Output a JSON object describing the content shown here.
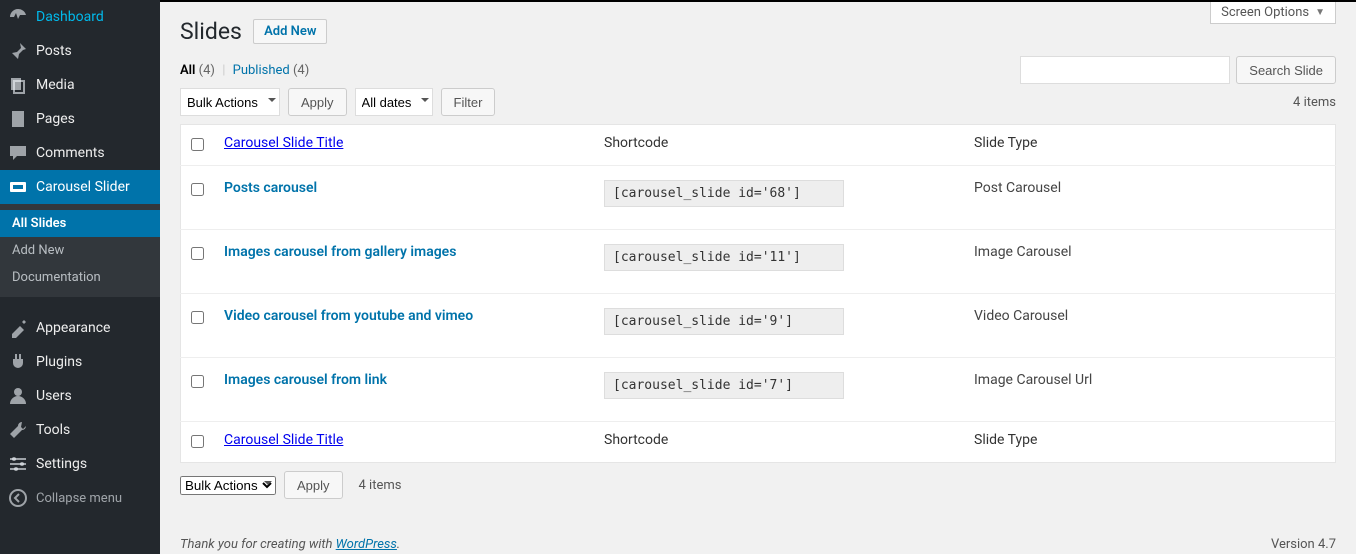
{
  "screen_options_label": "Screen Options",
  "page_title": "Slides",
  "add_new_label": "Add New",
  "subsubsub": {
    "all_label": "All",
    "all_count": "(4)",
    "published_label": "Published",
    "published_count": "(4)"
  },
  "search_button": "Search Slide",
  "bulk_actions_label": "Bulk Actions",
  "apply_label": "Apply",
  "all_dates_label": "All dates",
  "filter_label": "Filter",
  "items_count": "4 items",
  "columns": {
    "title": "Carousel Slide Title",
    "shortcode": "Shortcode",
    "type": "Slide Type"
  },
  "rows": [
    {
      "title": "Posts carousel",
      "shortcode": "[carousel_slide id='68']",
      "type": "Post Carousel"
    },
    {
      "title": "Images carousel from gallery images",
      "shortcode": "[carousel_slide id='11']",
      "type": "Image Carousel"
    },
    {
      "title": "Video carousel from youtube and vimeo",
      "shortcode": "[carousel_slide id='9']",
      "type": "Video Carousel"
    },
    {
      "title": "Images carousel from link",
      "shortcode": "[carousel_slide id='7']",
      "type": "Image Carousel Url"
    }
  ],
  "sidebar": {
    "items": [
      {
        "label": "Dashboard",
        "icon": "dashboard"
      },
      {
        "label": "Posts",
        "icon": "pin"
      },
      {
        "label": "Media",
        "icon": "media"
      },
      {
        "label": "Pages",
        "icon": "pages"
      },
      {
        "label": "Comments",
        "icon": "comments"
      },
      {
        "label": "Carousel Slider",
        "icon": "slider",
        "current": true,
        "submenu": [
          {
            "label": "All Slides",
            "current": true
          },
          {
            "label": "Add New"
          },
          {
            "label": "Documentation"
          }
        ]
      },
      {
        "label": "Appearance",
        "icon": "appearance"
      },
      {
        "label": "Plugins",
        "icon": "plugins"
      },
      {
        "label": "Users",
        "icon": "users"
      },
      {
        "label": "Tools",
        "icon": "tools"
      },
      {
        "label": "Settings",
        "icon": "settings"
      }
    ],
    "collapse_label": "Collapse menu"
  },
  "footer": {
    "thankyou_prefix": "Thank you for creating with ",
    "wordpress": "WordPress",
    "thankyou_suffix": ".",
    "version": "Version 4.7"
  }
}
